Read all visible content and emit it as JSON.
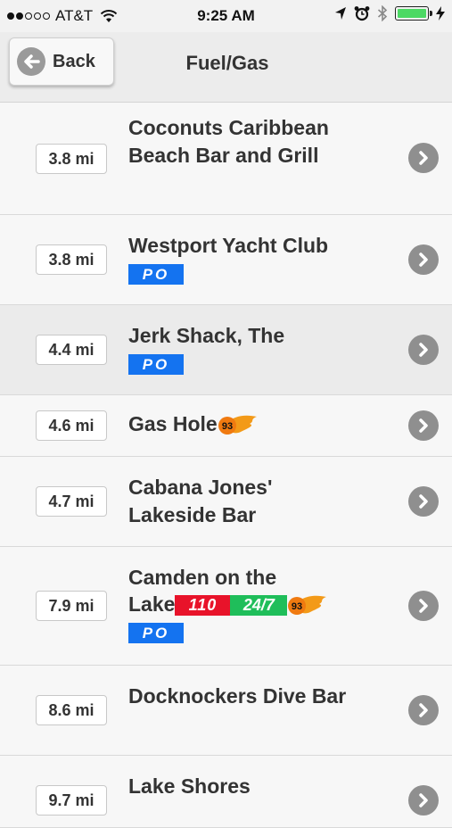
{
  "status_bar": {
    "carrier": "AT&T",
    "time": "9:25 AM",
    "battery_color": "#4cd964"
  },
  "navbar": {
    "back_label": "Back",
    "title": "Fuel/Gas"
  },
  "badges": {
    "po": "PO",
    "b110": "110",
    "b247": "24/7",
    "b93": "93"
  },
  "colors": {
    "po": "#1473f0",
    "b110": "#e8132a",
    "b247": "#1fbe5a"
  },
  "list": [
    {
      "distance": "3.8 mi",
      "name": "Coconuts Caribbean Beach Bar and Grill"
    },
    {
      "distance": "3.8 mi",
      "name": "Westport Yacht Club"
    },
    {
      "distance": "4.4 mi",
      "name": "Jerk Shack, The"
    },
    {
      "distance": "4.6 mi",
      "name": "Gas Hole"
    },
    {
      "distance": "4.7 mi",
      "name": "Cabana Jones' Lakeside Bar"
    },
    {
      "distance": "7.9 mi",
      "name_line1": "Camden on the",
      "name_line2": "Lake"
    },
    {
      "distance": "8.6 mi",
      "name": "Docknockers Dive Bar"
    },
    {
      "distance": "9.7 mi",
      "name": "Lake Shores"
    }
  ]
}
